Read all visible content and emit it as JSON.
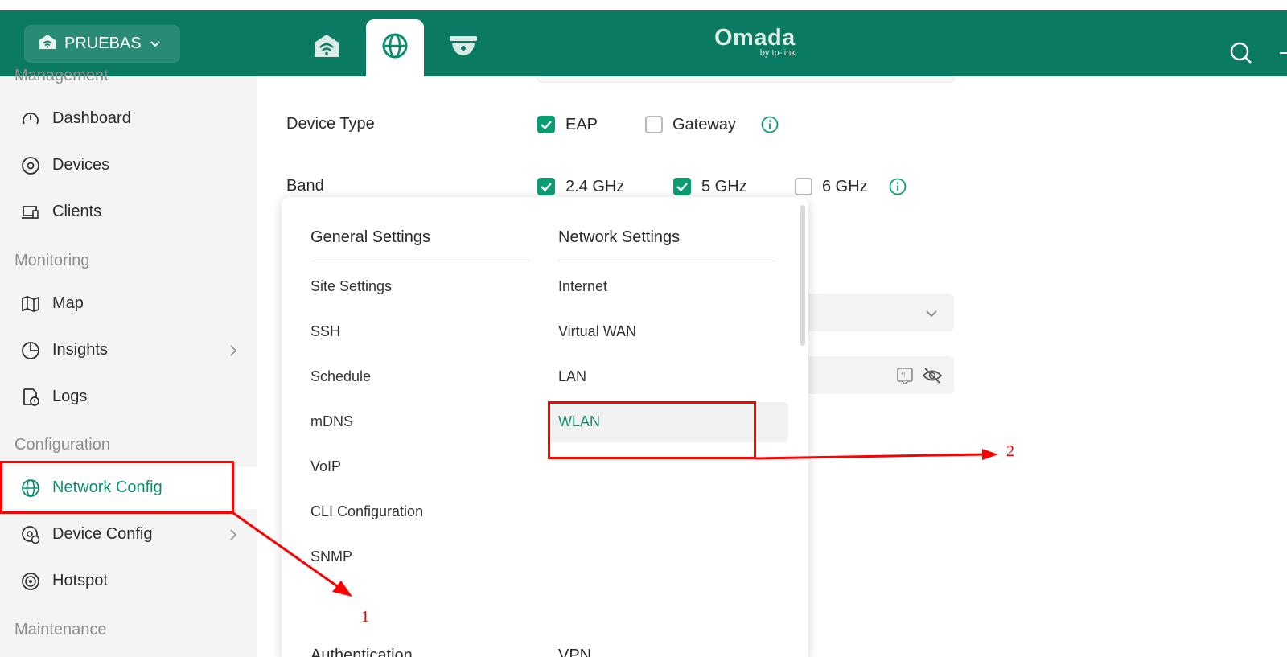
{
  "header": {
    "site_name": "PRUEBAS",
    "logo_main": "Omada",
    "logo_sub": "by tp-link",
    "tabs": [
      {
        "icon": "wifi-home-icon",
        "active": false
      },
      {
        "icon": "globe-icon",
        "active": true
      },
      {
        "icon": "camera-dome-icon",
        "active": false
      }
    ],
    "brand_color": "#0a7a62"
  },
  "sidebar": {
    "sections": {
      "management": "Management",
      "monitoring": "Monitoring",
      "configuration": "Configuration",
      "maintenance": "Maintenance"
    },
    "items": [
      {
        "label": "Dashboard",
        "icon": "gauge-icon"
      },
      {
        "label": "Devices",
        "icon": "device-icon"
      },
      {
        "label": "Clients",
        "icon": "clients-icon"
      },
      {
        "label": "Map",
        "icon": "map-icon"
      },
      {
        "label": "Insights",
        "icon": "pie-chart-icon"
      },
      {
        "label": "Logs",
        "icon": "logs-icon"
      },
      {
        "label": "Network Config",
        "icon": "globe-icon",
        "active": true
      },
      {
        "label": "Device Config",
        "icon": "device-config-icon"
      },
      {
        "label": "Hotspot",
        "icon": "hotspot-icon"
      }
    ]
  },
  "form": {
    "device_type_label": "Device Type",
    "device_type_options": [
      {
        "label": "EAP",
        "checked": true
      },
      {
        "label": "Gateway",
        "checked": false
      }
    ],
    "band_label": "Band",
    "band_options": [
      {
        "label": "2.4 GHz",
        "checked": true
      },
      {
        "label": "5 GHz",
        "checked": true
      },
      {
        "label": "6 GHz",
        "checked": false
      }
    ]
  },
  "menu": {
    "general_title": "General Settings",
    "general_items": [
      "Site Settings",
      "SSH",
      "Schedule",
      "mDNS",
      "VoIP",
      "CLI Configuration",
      "SNMP"
    ],
    "network_title": "Network Settings",
    "network_items": [
      "Internet",
      "Virtual WAN",
      "LAN",
      "WLAN"
    ],
    "selected_item": "WLAN",
    "bottom_left": "Authentication",
    "bottom_right": "VPN"
  },
  "annotations": {
    "step1": "1",
    "step2": "2",
    "color": "#ff0000"
  }
}
